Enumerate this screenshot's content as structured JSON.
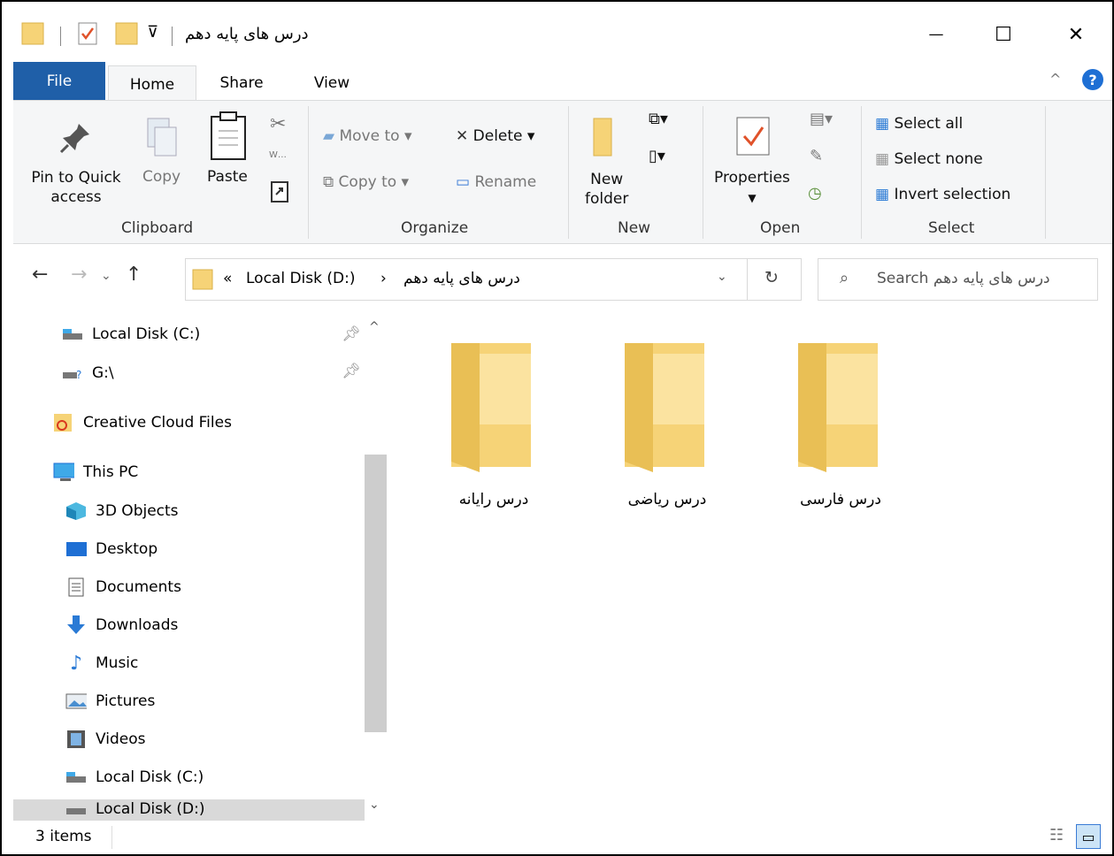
{
  "window": {
    "title": "درس های پایه دهم",
    "minimize": "—",
    "maximize": "☐",
    "close": "✕"
  },
  "tabs": {
    "file": "File",
    "home": "Home",
    "share": "Share",
    "view": "View"
  },
  "ribbon": {
    "clipboard": {
      "pin_label_1": "Pin to Quick",
      "pin_label_2": "access",
      "copy": "Copy",
      "paste": "Paste",
      "group": "Clipboard"
    },
    "organize": {
      "move_to": "Move to",
      "copy_to": "Copy to",
      "delete": "Delete",
      "rename": "Rename",
      "group": "Organize"
    },
    "new": {
      "new_folder_1": "New",
      "new_folder_2": "folder",
      "group": "New"
    },
    "open": {
      "properties": "Properties",
      "group": "Open"
    },
    "select": {
      "select_all": "Select all",
      "select_none": "Select none",
      "invert": "Invert selection",
      "group": "Select"
    }
  },
  "address": {
    "chevrons": "«",
    "crumb1": "Local Disk (D:)",
    "sep": "›",
    "crumb2": "درس های پایه دهم",
    "search_placeholder": "Search درس های پایه دهم"
  },
  "nav": {
    "items": [
      {
        "label": "Local Disk (C:)",
        "icon": "drive-icon"
      },
      {
        "label": "G:\\",
        "icon": "unknown-drive-icon"
      },
      {
        "label": "Creative Cloud Files",
        "icon": "creative-cloud-icon"
      },
      {
        "label": "This PC",
        "icon": "pc-icon"
      },
      {
        "label": "3D Objects",
        "icon": "3d-objects-icon"
      },
      {
        "label": "Desktop",
        "icon": "desktop-icon"
      },
      {
        "label": "Documents",
        "icon": "documents-icon"
      },
      {
        "label": "Downloads",
        "icon": "downloads-icon"
      },
      {
        "label": "Music",
        "icon": "music-icon"
      },
      {
        "label": "Pictures",
        "icon": "pictures-icon"
      },
      {
        "label": "Videos",
        "icon": "videos-icon"
      },
      {
        "label": "Local Disk (C:)",
        "icon": "drive-icon"
      },
      {
        "label": "Local Disk (D:)",
        "icon": "drive-icon"
      }
    ]
  },
  "content": {
    "folders": [
      {
        "label": "درس رایانه"
      },
      {
        "label": "درس ریاضی"
      },
      {
        "label": "درس فارسی"
      }
    ]
  },
  "status": {
    "count": "3 items"
  },
  "colors": {
    "file_tab": "#1f5fa8",
    "folder": "#f6d377",
    "accent": "#1e6fd4"
  }
}
